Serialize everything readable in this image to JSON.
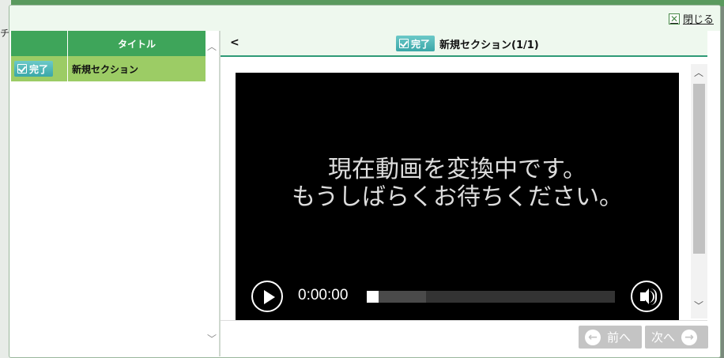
{
  "background": {
    "frag_text": "チ"
  },
  "dialog": {
    "close_label": "閉じる"
  },
  "list": {
    "header_title": "タイトル",
    "rows": [
      {
        "status": "完了",
        "title": "新規セクション"
      }
    ]
  },
  "viewer": {
    "back_label": "<",
    "status": "完了",
    "section_title": "新規セクション(1/1)",
    "message_line1": "現在動画を変換中です。",
    "message_line2": "もうしばらくお待ちください。",
    "time": "0:00:00",
    "progress": 0.0,
    "buffered": 0.24,
    "prev_label": "前へ",
    "next_label": "次へ"
  },
  "colors": {
    "header_green": "#3ea55a",
    "row_green": "#9ccc65",
    "badge_teal": "#3aa7a8",
    "accent_line": "#2f9a77"
  }
}
